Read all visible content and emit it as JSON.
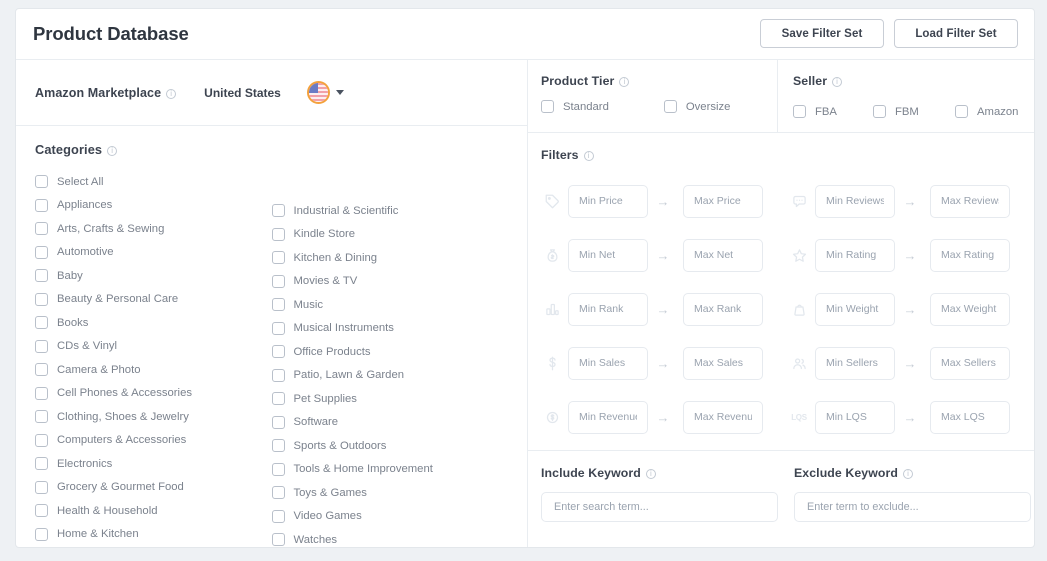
{
  "header": {
    "title": "Product Database",
    "save_button": "Save Filter Set",
    "load_button": "Load Filter Set"
  },
  "marketplace": {
    "label": "Amazon Marketplace",
    "value": "United States",
    "flag_icon": "us-flag-icon",
    "caret_icon": "caret-down-icon"
  },
  "categories": {
    "title": "Categories",
    "column1": [
      "Select All",
      "Appliances",
      "Arts, Crafts & Sewing",
      "Automotive",
      "Baby",
      "Beauty & Personal Care",
      "Books",
      "CDs & Vinyl",
      "Camera & Photo",
      "Cell Phones & Accessories",
      "Clothing, Shoes & Jewelry",
      "Computers & Accessories",
      "Electronics",
      "Grocery & Gourmet Food",
      "Health & Household",
      "Home & Kitchen"
    ],
    "column2": [
      "Industrial & Scientific",
      "Kindle Store",
      "Kitchen & Dining",
      "Movies & TV",
      "Music",
      "Musical Instruments",
      "Office Products",
      "Patio, Lawn & Garden",
      "Pet Supplies",
      "Software",
      "Sports & Outdoors",
      "Tools & Home Improvement",
      "Toys & Games",
      "Video Games",
      "Watches"
    ]
  },
  "product_tier": {
    "title": "Product Tier",
    "options": [
      "Standard",
      "Oversize"
    ]
  },
  "seller": {
    "title": "Seller",
    "options": [
      "FBA",
      "FBM",
      "Amazon"
    ]
  },
  "filters": {
    "title": "Filters",
    "arrow_glyph": "→",
    "left_rows": [
      {
        "icon": "price-tag-icon",
        "min_placeholder": "Min Price",
        "max_placeholder": "Max Price",
        "min_value": "",
        "max_value": ""
      },
      {
        "icon": "money-bag-icon",
        "min_placeholder": "Min Net",
        "max_placeholder": "Max Net",
        "min_value": "",
        "max_value": ""
      },
      {
        "icon": "bar-chart-icon",
        "min_placeholder": "Min Rank",
        "max_placeholder": "Max Rank",
        "min_value": "",
        "max_value": ""
      },
      {
        "icon": "dollar-sign-icon",
        "min_placeholder": "Min Sales",
        "max_placeholder": "Max Sales",
        "min_value": "",
        "max_value": ""
      },
      {
        "icon": "revenue-coin-icon",
        "min_placeholder": "Min Revenue",
        "max_placeholder": "Max Revenue",
        "min_value": "",
        "max_value": ""
      }
    ],
    "right_rows": [
      {
        "icon": "chat-bubble-icon",
        "min_placeholder": "Min Reviews",
        "max_placeholder": "Max Reviews",
        "min_value": "",
        "max_value": ""
      },
      {
        "icon": "star-icon",
        "min_placeholder": "Min Rating",
        "max_placeholder": "Max Rating",
        "min_value": "",
        "max_value": ""
      },
      {
        "icon": "weight-icon",
        "min_placeholder": "Min Weight",
        "max_placeholder": "Max Weight",
        "min_value": "",
        "max_value": ""
      },
      {
        "icon": "sellers-people-icon",
        "min_placeholder": "Min Sellers",
        "max_placeholder": "Max Sellers",
        "min_value": "",
        "max_value": ""
      },
      {
        "icon": "lqs-badge-icon",
        "icon_text": "LQS",
        "min_placeholder": "Min LQS",
        "max_placeholder": "Max LQS",
        "min_value": "",
        "max_value": ""
      }
    ]
  },
  "keywords": {
    "include_label": "Include Keyword",
    "include_placeholder": "Enter search term...",
    "include_value": "",
    "exclude_label": "Exclude Keyword",
    "exclude_placeholder": "Enter term to exclude...",
    "exclude_value": ""
  },
  "colors": {
    "accent": "#f4a13c",
    "text_primary": "#3d4450",
    "text_muted": "#7b828d",
    "border": "#e6eaef",
    "card_bg": "#ffffff",
    "page_bg": "#eef1f4"
  }
}
